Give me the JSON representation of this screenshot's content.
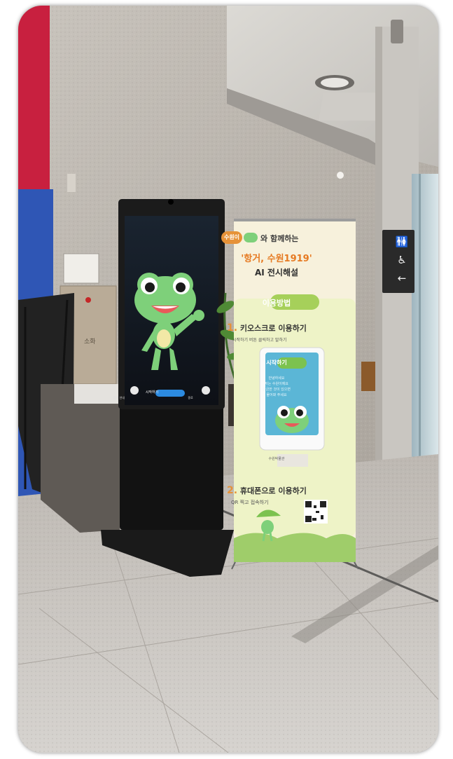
{
  "banner": {
    "mascot_tag": "수원이",
    "headline_suffix": "와 함께하는",
    "title_line": "'항거, 수원1919'",
    "subtitle": "AI 전시해설",
    "how_to_use": "이용방법",
    "step1_number": "1.",
    "step1_title": "키오스크로 이용하기",
    "step1_desc": "시작하기 버튼 클릭하고 말하기",
    "kiosk_start_button": "시작하기",
    "kiosk_screen_text": "안녕하세요\n저는 수원이에요\n궁금한 것이 있으면\n물어봐 주세요",
    "kiosk_footer": "수원박물관",
    "step2_number": "2.",
    "step2_title": "휴대폰으로 이용하기",
    "step2_desc": "QR 찍고 접속하기"
  },
  "kiosk": {
    "screen_button_label": "시작하기",
    "left_caption": "음성 안내",
    "right_caption": "종료"
  },
  "sign": {
    "icons": [
      "restroom-icon",
      "wheelchair-icon",
      "arrow-left-icon"
    ]
  },
  "wall_box_label": "소화",
  "colors": {
    "wall": "#b9b3ab",
    "floor": "#cfcbc6",
    "banner_bg": "#f7f1dc",
    "banner_accent": "#e69238",
    "banner_green": "#7cc24f",
    "kiosk_body": "#141414",
    "frog_green": "#7ed07a"
  }
}
